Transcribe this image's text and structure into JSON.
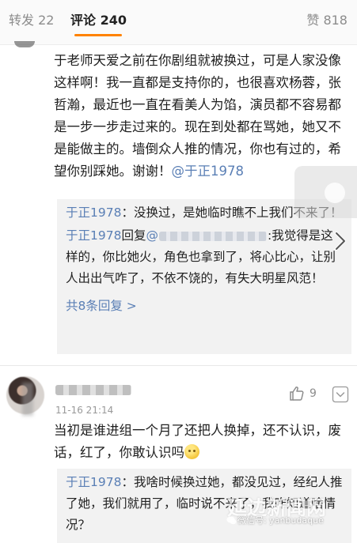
{
  "tabs": {
    "repost": "转发 22",
    "comments": "评论 240",
    "likes": "赞 818"
  },
  "comment1": {
    "text": "于老师天爱之前在你剧组就被换过，可是人家没像这样啊！我一直都是支持你的，也很喜欢杨蓉，张哲瀚，最近也一直在看美人为馅，演员都不容易都是一步一步走过来的。现在到处都在骂她，她又不是能做主的。墙倒众人推的情况，你也有过的，希望你别踩她。谢谢！",
    "mention": "@于正1978"
  },
  "replies1": [
    {
      "author": "于正1978",
      "text": "：没换过，是她临时瞧不上我们不来了！"
    },
    {
      "author": "于正1978",
      "reply_word": "回复",
      "mention_prefix": "@",
      "text": ":我觉得是这样的，你比她火，角色也拿到了，将心比心，让别人出出气咋了，不依不饶的，有失大明星风范！"
    }
  ],
  "more_replies": "共8条回复 >",
  "comment2": {
    "timestamp": "11-16 21:14",
    "like_count": "9",
    "text": "当初是谁进组一个月了还把人换掉，还不认识，废话，红了，你敢认识吗"
  },
  "replies2": [
    {
      "author": "于正1978",
      "text": "：我啥时候换过她，都没见过，经纪人推了她，我们就用了，临时说不来了，我咋知道啥情况？"
    }
  ],
  "watermark": {
    "big": "延边新闻网",
    "small": "微信号: yanbudaque"
  },
  "colors": {
    "accent": "#ff8200",
    "link": "#5a7fb5",
    "reply_bg": "#f2f2f2"
  },
  "icons": {
    "like": "thumbs-up-icon",
    "more": "chevron-down-icon",
    "next": "chevron-right-icon",
    "wechat": "wechat-icon"
  }
}
